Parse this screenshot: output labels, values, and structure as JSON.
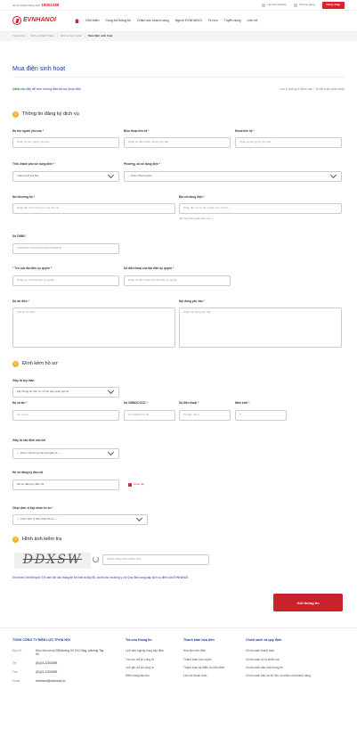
{
  "topbar": {
    "hotline_label": "Hỗ trợ khách hàng 24/7",
    "hotline_number": "19001288",
    "link1": "Liên kết website",
    "link2": "Tải ứng dụng",
    "login": "Đăng nhập"
  },
  "logo": {
    "a": "EVN",
    "b": "HANOI"
  },
  "nav": [
    "Giới thiệu",
    "Công bố thông tin",
    "Chăm sóc khách hàng",
    "Người EVNHANOI",
    "Tin tức",
    "Tuyển dụng",
    "Liên hệ"
  ],
  "breadcrumb": [
    "Trang chủ",
    "Dịch vụ khách hàng",
    "Dịch vụ trực tuyến",
    "Mua điện sinh hoạt"
  ],
  "page_title": "Mua điện sinh hoạt",
  "guide": {
    "prefix": "Click",
    "text": " vào đây để xem hướng dẫn thủ tục thực hiện"
  },
  "note": "Lưu ý những ô đánh dấu * là bắt buộc phải nhập",
  "section1": {
    "num": "1",
    "title": "Thông tin đăng ký dịch vụ"
  },
  "fields": {
    "name": {
      "label": "Họ tên người yêu cầu",
      "placeholder": "Nhập họ tên người yêu cầu"
    },
    "phone": {
      "label": "Điện thoại liên hệ",
      "placeholder": "Nhập số điện thoại người yêu cầu"
    },
    "email": {
      "label": "Email liên hệ",
      "placeholder": "Nhập email người yêu cầu"
    },
    "province": {
      "label": "Tỉnh, thành phố sử dụng điện",
      "value": "Thành phố Hà Nội"
    },
    "ward": {
      "label": "Phường, xã sử dụng điện",
      "value": "-- Chọn Phường/xã --"
    },
    "residence": {
      "label": "Nơi thường trú",
      "placeholder": "Nhập địa chỉ thường trú của chủ hộ"
    },
    "usage_address": {
      "label": "Địa chỉ dùng điện",
      "placeholder": "Nhập địa chỉ sử dụng điện của chủ hộ",
      "hint": "(Số nhà, đường phố, thôn,xóm,...)"
    },
    "idcard": {
      "label": "Số CMND",
      "placeholder": "CMND/Hộ chiếu/CMCAND/CMQĐND"
    },
    "auth_name": {
      "label": "Tên của đại diện ủy quyền",
      "placeholder": "Nhập tên của đại diện ủy quyền"
    },
    "auth_phone": {
      "label": "Số điện thoại của đại diện ủy quyền",
      "placeholder": "Nhập số điện thoại của đại diện ủy quyền"
    },
    "project": {
      "label": "Dự án điện",
      "placeholder": "Tên dự án điện"
    },
    "request": {
      "label": "Nội dung yêu cầu",
      "placeholder": "Nhập nội dung yêu cầu"
    }
  },
  "section2": {
    "num": "2",
    "title": "Đính kèm hồ sơ"
  },
  "attach": {
    "idpaper_label": "Giấy tờ tùy thân",
    "idpaper_value": "Lấy thông tin trên cơ sở dữ liệu quốc gia về",
    "hoten_label": "Họ và tên",
    "hoten_ph": "Họ và tên",
    "cccd_label": "Số CMND/CCCD",
    "cccd_ph": "Số CMND/CCCD",
    "sdt_label": "Số điện thoại",
    "sdt_ph": "Số điện thoại",
    "ns_label": "Năm sinh",
    "ns_ph": "0",
    "owner_label": "Giấy tờ xác định chủ thể",
    "owner_value": "--- Chọn một trong các loại giấy tờ ---",
    "form_label": "Hồ sơ đăng ký đấu nối",
    "form_value": "Hồ sơ đăng ký đấu nối",
    "upload": "Chọn tệp",
    "unit_label": "Chọn đơn vị tiếp nhận hồ sơ",
    "unit_value": "--- Chọn đơn vị tiếp nhận hồ sơ ---"
  },
  "section3": {
    "num": "3",
    "title": "Hình ảnh kiểm tra"
  },
  "captcha": {
    "text": "DDXSW",
    "placeholder": "NHẬP HÌNH ẢNH KIỂM TRA"
  },
  "commit": "Khi nhấn Gửi thông tin Tôi cam kết các thông tin kê khai là đầy đủ, chính xác và đồng ý với Quy định cung cấp dịch vụ điện của EVNHANOI.",
  "submit": "Gửi thông tin",
  "footer": {
    "company": "TỔNG CÔNG TY ĐIỆN LỰC TP.HÀ NỘI",
    "rows": [
      {
        "k": "Địa chỉ:",
        "v": "Khu Liên cơ số 258 đường Võ Chí Công, phường Tây Hồ"
      },
      {
        "k": "Tel:",
        "v": "(84)24 22200898"
      },
      {
        "k": "Fax:",
        "v": "(84)24 22200899"
      },
      {
        "k": "Email:",
        "v": "evnhanoi@evnhanoi.vn"
      }
    ],
    "col2": {
      "title": "Tra cứu thông tin",
      "items": [
        "Lịch tạm ngừng cung cấp điện",
        "Tra cứu chỉ số công tơ",
        "Lịch ghi chỉ số công tơ",
        "Điểm năng tiêu thụ"
      ]
    },
    "col3": {
      "title": "Thanh toán hóa đơn",
      "items": [
        "Hóa đơn tiền điện",
        "Thanh toán trực tuyến",
        "Thanh toán tại điểm thu tiền điện",
        "Lịch sử thanh toán"
      ]
    },
    "col4": {
      "title": "Chính sách và quy định",
      "items": [
        "Chính sách thanh toán",
        "Chính sách xử lý khiếu nại",
        "Chính sách bảo mật thông tin",
        "Chính sách bảo vệ dữ liệu cá nhân của khách hàng"
      ]
    }
  }
}
